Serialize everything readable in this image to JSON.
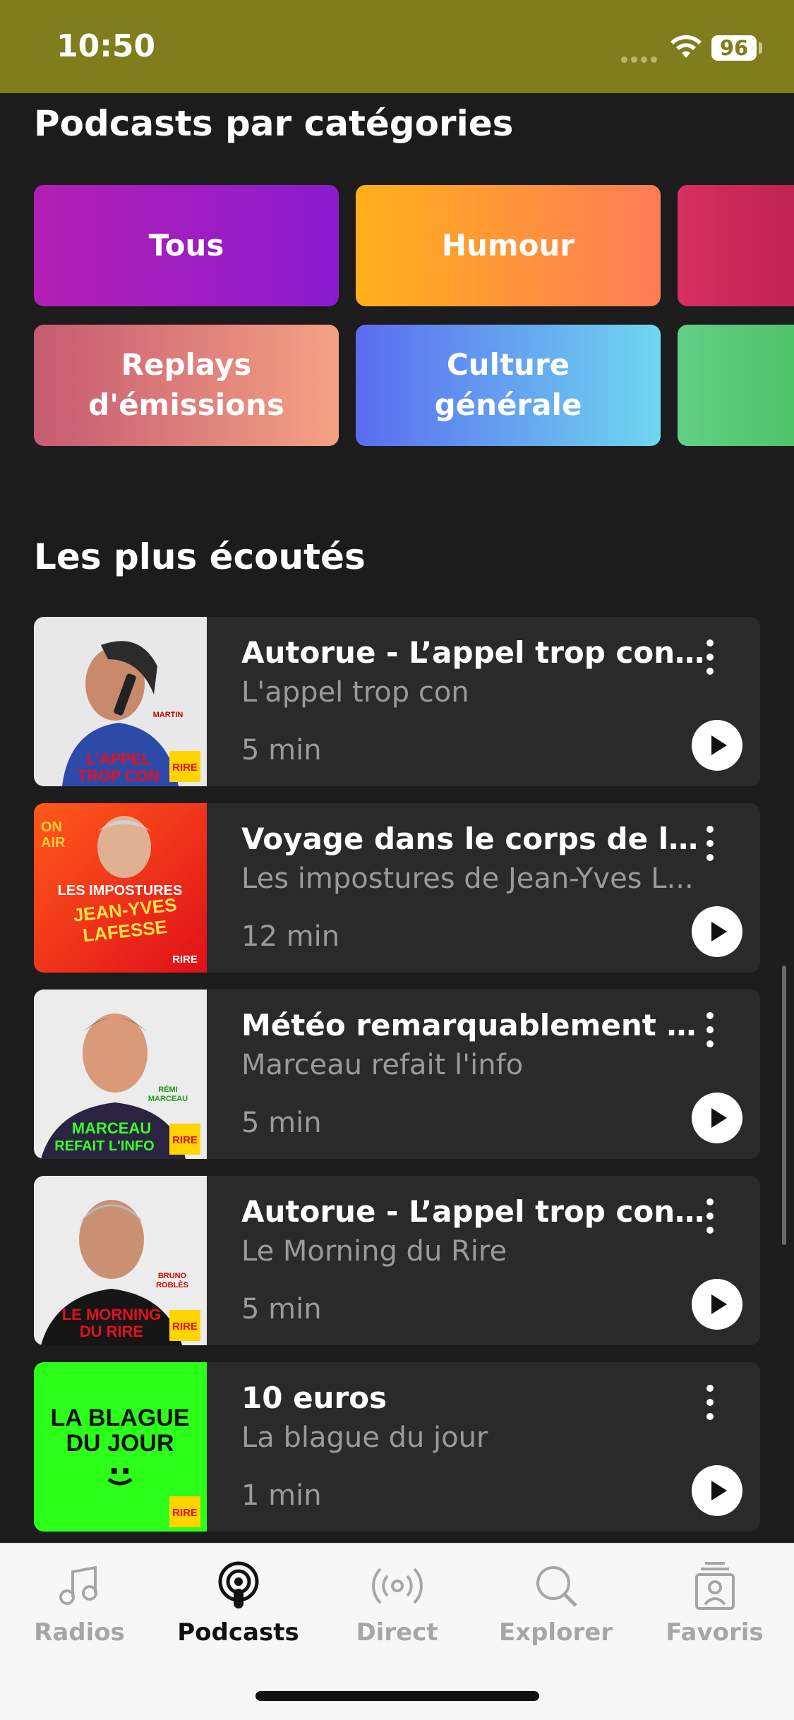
{
  "status_bar": {
    "time": "10:50",
    "battery": "96"
  },
  "categories_section": {
    "title": "Podcasts par catégories"
  },
  "categories": [
    {
      "label": "Tous",
      "colors": [
        "#b31fb2",
        "#8a1cd0"
      ]
    },
    {
      "label": "Humour",
      "colors": [
        "#ffb01b",
        "#ff7b57"
      ]
    },
    {
      "label": "Replays\nd'émissions",
      "colors": [
        "#c65a72",
        "#f4a283"
      ]
    },
    {
      "label": "Culture\ngénérale",
      "colors": [
        "#5a6cf0",
        "#6fd7f0"
      ]
    }
  ],
  "popular_section": {
    "title": "Les plus écoutés"
  },
  "podcasts": [
    {
      "title": "Autorue - L’appel trop con de...",
      "show": "L'appel trop con",
      "duration": "5 min",
      "thumb_text": "L'APPEL TROP CON",
      "host": "MARTIN"
    },
    {
      "title": "Voyage dans le corps de la va...",
      "show": "Les impostures de Jean-Yves L...",
      "duration": "12 min",
      "thumb_text": "LES IMPOSTURES DE JEAN-YVES LAFESSE"
    },
    {
      "title": "Météo remarquablement do...",
      "show": "Marceau refait l'info",
      "duration": "5 min",
      "thumb_text": "MARCEAU REFAIT L'INFO",
      "host": "RÉMI MARCEAU"
    },
    {
      "title": "Autorue - L’appel trop con de...",
      "show": "Le Morning du Rire",
      "duration": "5 min",
      "thumb_text": "LE MORNING DU RIRE",
      "host": "BRUNO ROBLÈS"
    },
    {
      "title": "10 euros",
      "show": "La blague du jour",
      "duration": "1 min",
      "thumb_text": "LA BLAGUE DU JOUR"
    }
  ],
  "brand_logo": "RIRE",
  "tabs": [
    {
      "label": "Radios",
      "icon": "music-note-icon",
      "active": false
    },
    {
      "label": "Podcasts",
      "icon": "podcast-icon",
      "active": true
    },
    {
      "label": "Direct",
      "icon": "broadcast-icon",
      "active": false
    },
    {
      "label": "Explorer",
      "icon": "search-icon",
      "active": false
    },
    {
      "label": "Favoris",
      "icon": "favorites-icon",
      "active": false
    }
  ],
  "colors": {
    "status_bar": "#7f7d1c",
    "background": "#1c1c1c",
    "card": "#2a2a2a",
    "tab_bar": "#f7f7f7"
  }
}
